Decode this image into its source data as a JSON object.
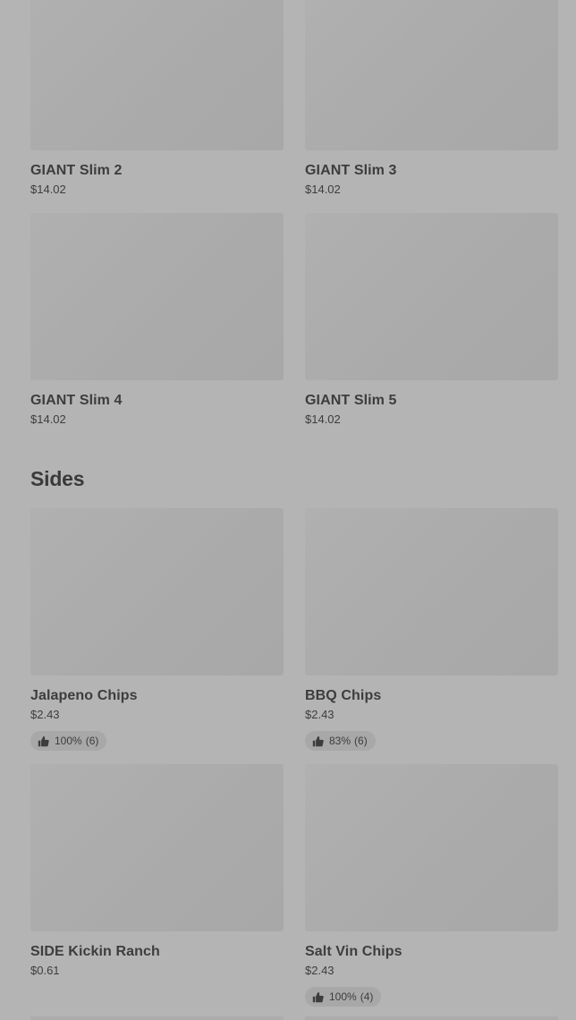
{
  "menu": {
    "top_items": [
      {
        "name": "GIANT Slim 2",
        "price": "$14.02"
      },
      {
        "name": "GIANT Slim 3",
        "price": "$14.02"
      },
      {
        "name": "GIANT Slim 4",
        "price": "$14.02"
      },
      {
        "name": "GIANT Slim 5",
        "price": "$14.02"
      }
    ],
    "sides": {
      "title": "Sides",
      "items": [
        {
          "name": "Jalapeno Chips",
          "price": "$2.43",
          "rating_pct": "100%",
          "rating_count": "(6)"
        },
        {
          "name": "BBQ Chips",
          "price": "$2.43",
          "rating_pct": "83%",
          "rating_count": "(6)"
        },
        {
          "name": "SIDE Kickin Ranch",
          "price": "$0.61"
        },
        {
          "name": "Salt Vin Chips",
          "price": "$2.43",
          "rating_pct": "100%",
          "rating_count": "(4)"
        }
      ]
    }
  },
  "icons": {
    "rating": "thumbs-up-icon"
  },
  "colors": {
    "background": "#b4b4b4",
    "image_placeholder": "#aaaaaa",
    "text": "#3d3d3d",
    "rating_pill": "#a8a8a8"
  }
}
